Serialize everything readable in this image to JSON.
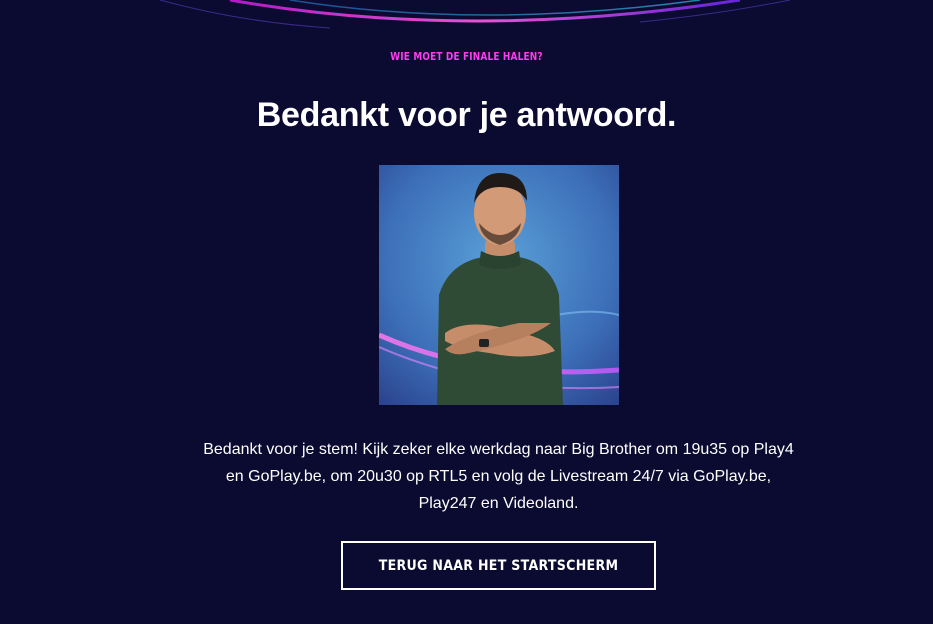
{
  "header": {
    "kicker": "WIE MOET DE FINALE HALEN?",
    "title": "Bedankt voor je antwoord."
  },
  "main": {
    "photo_alt": "Kandidaat",
    "message": "Bedankt voor je stem! Kijk zeker elke werkdag naar Big Brother om 19u35 op Play4 en GoPlay.be, om 20u30 op RTL5 en volg de Livestream 24/7 via GoPlay.be, Play247 en Videoland.",
    "back_button_label": "TERUG NAAR HET STARTSCHERM"
  },
  "colors": {
    "background": "#0b0a31",
    "accent": "#ff3df0",
    "text": "#ffffff"
  }
}
